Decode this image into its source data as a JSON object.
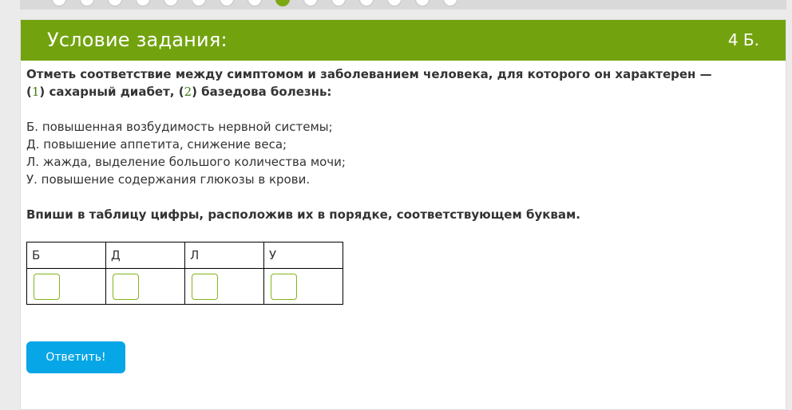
{
  "progress": {
    "total_steps": 15,
    "active_step": 9
  },
  "header": {
    "title": "Условие задания:",
    "points": "4 Б."
  },
  "task": {
    "question_part1": "Отметь соответствие между симптомом и заболеванием человека, для которого он характерен — (",
    "num1": "1",
    "question_part2": ") сахарный диабет, (",
    "num2": "2",
    "question_part3": ") базедова болезнь:",
    "options": [
      "Б. повышенная возбудимость нервной системы;",
      "Д. повышение аппетита, снижение веса;",
      "Л. жажда, выделение большого количества мочи;",
      "У. повышение содержания глюкозы в крови."
    ],
    "instruction": "Впиши в таблицу цифры, расположив их в порядке, соответствующем буквам."
  },
  "table": {
    "letters": [
      "Б",
      "Д",
      "Л",
      "У"
    ],
    "values": [
      "",
      "",
      "",
      ""
    ]
  },
  "submit_label": "Ответить!",
  "colors": {
    "header_green": "#72a30f",
    "button_blue": "#07a6e6",
    "input_border": "#82b51e"
  }
}
